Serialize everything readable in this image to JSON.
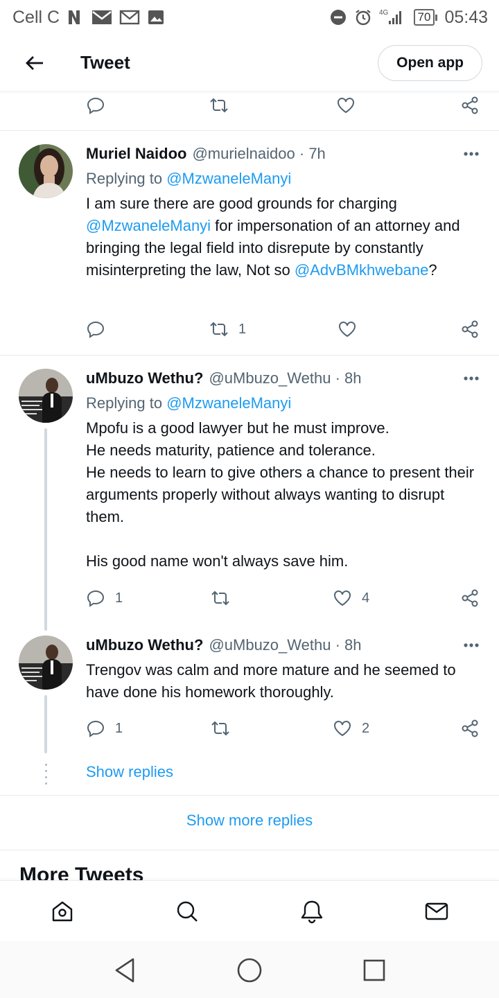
{
  "status_bar": {
    "carrier": "Cell C",
    "network": "4G",
    "battery": "70",
    "time": "05:43"
  },
  "header": {
    "title": "Tweet",
    "open_app_label": "Open app"
  },
  "top_actions": {
    "retweets": "",
    "likes": ""
  },
  "tweets": [
    {
      "name": "Muriel Naidoo",
      "handle": "@murielnaidoo",
      "time": "· 7h",
      "replying_prefix": "Replying to ",
      "replying_to": "@MzwaneleManyi",
      "text_1": "I am sure there are good grounds for charging ",
      "mention_1": "@MzwaneleManyi",
      "text_2": " for impersonation of an attorney and bringing the legal field into disrepute by constantly misinterpreting the law, Not so ",
      "mention_2": "@AdvBMkhwebane",
      "text_3": "?",
      "replies": "",
      "retweets": "1",
      "likes": ""
    },
    {
      "name": "uMbuzo Wethu?",
      "handle": "@uMbuzo_Wethu",
      "time": "· 8h",
      "replying_prefix": "Replying to ",
      "replying_to": "@MzwaneleManyi",
      "line_1": "Mpofu is a good lawyer but he must improve.",
      "line_2": "He needs maturity, patience and tolerance.",
      "line_3": "He needs to learn to give others a chance to present their arguments properly without always wanting to disrupt them.",
      "line_4": "His good name won't always save him.",
      "replies": "1",
      "retweets": "",
      "likes": "4"
    },
    {
      "name": "uMbuzo Wethu?",
      "handle": "@uMbuzo_Wethu",
      "time": "· 8h",
      "text": "Trengov was calm and more mature and he seemed to have done his homework thoroughly.",
      "replies": "1",
      "retweets": "",
      "likes": "2"
    }
  ],
  "show_replies_label": "Show replies",
  "show_more_replies_label": "Show more replies",
  "more_tweets_title": "More Tweets",
  "icons": {
    "reply": "speech-bubble-icon",
    "retweet": "retweet-icon",
    "like": "heart-icon",
    "share": "share-icon",
    "more": "more-dots-icon"
  },
  "colors": {
    "link": "#1d9bf0",
    "secondary_text": "#536471"
  }
}
